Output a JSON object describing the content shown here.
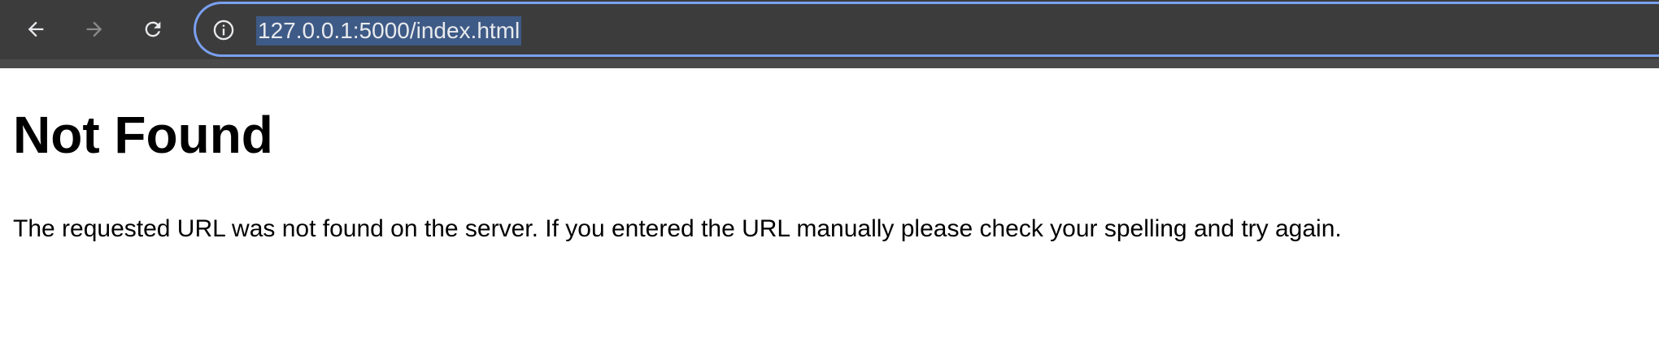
{
  "browser": {
    "url": "127.0.0.1:5000/index.html",
    "icons": {
      "back": "back-arrow-icon",
      "forward": "forward-arrow-icon",
      "reload": "reload-icon",
      "site_info": "info-icon"
    },
    "colors": {
      "toolbar_bg": "#3c3c3c",
      "focus_ring": "#7aa0f0",
      "url_selection_bg": "#3e5a86",
      "icon_active": "#e8eaed",
      "icon_disabled": "#8a8a8a"
    }
  },
  "page": {
    "title": "Not Found",
    "message": "The requested URL was not found on the server. If you entered the URL manually please check your spelling and try again."
  }
}
